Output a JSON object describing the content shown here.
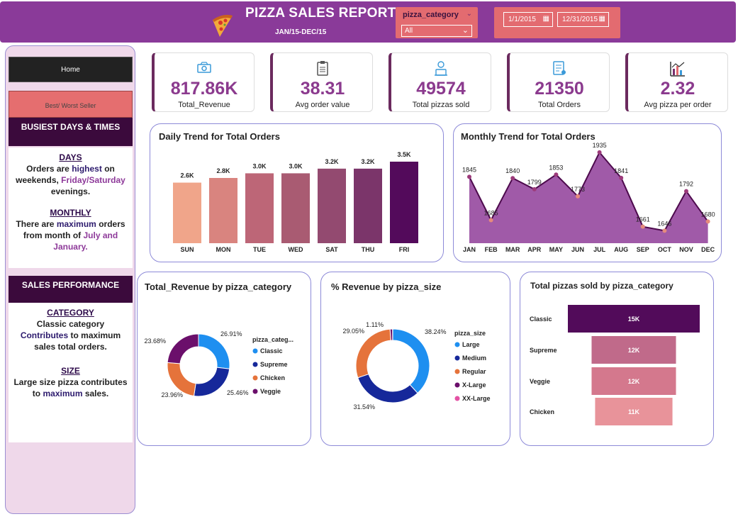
{
  "header": {
    "title": "PIZZA SALES REPORT",
    "subtitle": "JAN/15-DEC/15",
    "category_slicer_label": "pizza_category",
    "category_slicer_value": "All",
    "date_start": "1/1/2015",
    "date_end": "12/31/2015",
    "bg_color": "#8a3a99",
    "slicer_color": "#e36b70"
  },
  "nav": {
    "home_label": "Home",
    "best_worst_label": "Best/ Worst Seller"
  },
  "sidebar": {
    "busiest_heading": "BUSIEST DAYS & TIMES",
    "days_title": "DAYS",
    "days_p1": "Orders are ",
    "days_p2": "highest",
    "days_p3": " on weekends, ",
    "days_p4": "Friday/Saturday",
    "days_p5": " evenings.",
    "monthly_title": "MONTHLY",
    "monthly_p1": "There are ",
    "monthly_p2": "maximum",
    "monthly_p3": " orders from month of ",
    "monthly_p4": "July and January.",
    "sales_heading": "SALES PERFORMANCE",
    "category_title": "CATEGORY",
    "category_p1": "Classic category ",
    "category_p2": "Contributes",
    "category_p3": " to maximum sales total orders.",
    "size_title": "SIZE",
    "size_p1": "Large  size pizza contributes to ",
    "size_p2": "maximum",
    "size_p3": " sales."
  },
  "kpis": [
    {
      "value": "817.86K",
      "label": "Total_Revenue",
      "icon": "money-icon"
    },
    {
      "value": "38.31",
      "label": "Avg order value",
      "icon": "clipboard-icon"
    },
    {
      "value": "49574",
      "label": "Total pizzas sold",
      "icon": "delivery-icon"
    },
    {
      "value": "21350",
      "label": "Total Orders",
      "icon": "order-list-icon"
    },
    {
      "value": "2.32",
      "label": "Avg pizza per order",
      "icon": "bar-chart-icon"
    }
  ],
  "chart_data": [
    {
      "type": "bar",
      "title": "Daily Trend for Total Orders",
      "categories": [
        "SUN",
        "MON",
        "TUE",
        "WED",
        "SAT",
        "THU",
        "FRI"
      ],
      "values": [
        2.6,
        2.8,
        3.0,
        3.0,
        3.2,
        3.2,
        3.5
      ],
      "data_labels": [
        "2.6K",
        "2.8K",
        "3.0K",
        "3.0K",
        "3.2K",
        "3.2K",
        "3.5K"
      ],
      "colors": [
        "#f0a58a",
        "#d9847f",
        "#bd6677",
        "#a95b72",
        "#934a70",
        "#7b356a",
        "#530a5b"
      ],
      "ylim": [
        0,
        3.5
      ]
    },
    {
      "type": "area",
      "title": "Monthly Trend for Total Orders",
      "categories": [
        "JAN",
        "FEB",
        "MAR",
        "APR",
        "MAY",
        "JUN",
        "JUL",
        "AUG",
        "SEP",
        "OCT",
        "NOV",
        "DEC"
      ],
      "values": [
        1845,
        1685,
        1840,
        1799,
        1853,
        1773,
        1935,
        1841,
        1661,
        1646,
        1792,
        1680
      ],
      "ylim": [
        1600,
        1940
      ],
      "colors": {
        "fill": "#a05aa8",
        "line": "#4d0a4d",
        "point_high": "#9c3a7a",
        "point_low": "#e58b7d"
      }
    },
    {
      "type": "pie",
      "title": "Total_Revenue by pizza_category",
      "legend_title": "pizza_categ...",
      "labels": [
        "Classic",
        "Supreme",
        "Chicken",
        "Veggie"
      ],
      "values": [
        26.91,
        25.46,
        23.96,
        23.68
      ],
      "value_labels": [
        "26.91%",
        "25.46%",
        "23.96%",
        "23.68%"
      ],
      "colors": [
        "#1e8ff0",
        "#16289a",
        "#e5733b",
        "#6b0f6b"
      ]
    },
    {
      "type": "pie",
      "title": "% Revenue by pizza_size",
      "legend_title": "pizza_size",
      "labels": [
        "Large",
        "Medium",
        "Regular",
        "X-Large",
        "XX-Large"
      ],
      "values": [
        38.24,
        31.54,
        29.05,
        1.11,
        0.06
      ],
      "value_labels": [
        "38.24%",
        "31.54%",
        "29.05%",
        "1.11%",
        ""
      ],
      "colors": [
        "#1e8ff0",
        "#16289a",
        "#e5733b",
        "#6b0f6b",
        "#e452a4"
      ]
    },
    {
      "type": "bar",
      "orientation": "horizontal-funnel",
      "title": "Total pizzas sold by pizza_category",
      "categories": [
        "Classic",
        "Supreme",
        "Veggie",
        "Chicken"
      ],
      "values": [
        15,
        12,
        12,
        11
      ],
      "data_labels": [
        "15K",
        "12K",
        "12K",
        "11K"
      ],
      "colors": [
        "#520b5a",
        "#c06a8a",
        "#d4788d",
        "#e8939a"
      ]
    }
  ]
}
